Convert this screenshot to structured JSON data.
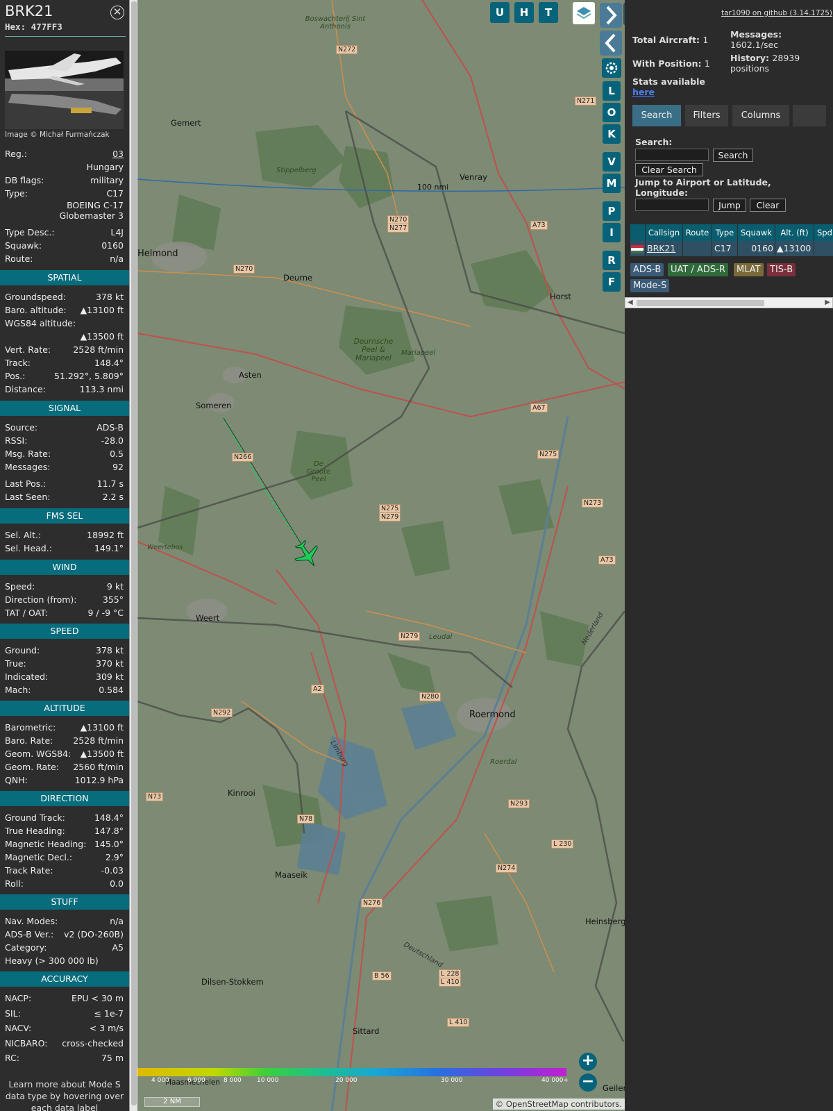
{
  "aircraft": {
    "callsign": "BRK21",
    "hex_label": "Hex:",
    "hex": "477FF3",
    "photo_credit": "Image © Michał Furmańczak",
    "reg_label": "Reg.:",
    "reg": "03",
    "country": "Hungary",
    "dbflags_label": "DB flags:",
    "dbflags": "military",
    "type_label": "Type:",
    "type": "C17",
    "type_name_1": "BOEING C-17",
    "type_name_2": "Globemaster 3",
    "typedesc_label": "Type Desc.:",
    "typedesc": "L4J",
    "squawk_label": "Squawk:",
    "squawk": "0160",
    "route_label": "Route:",
    "route": "n/a"
  },
  "sections": {
    "spatial": "SPATIAL",
    "signal": "SIGNAL",
    "fmssel": "FMS SEL",
    "wind": "WIND",
    "speed": "SPEED",
    "altitude": "ALTITUDE",
    "direction": "DIRECTION",
    "stuff": "STUFF",
    "accuracy": "ACCURACY"
  },
  "spatial": [
    {
      "k": "Groundspeed:",
      "v": "378 kt"
    },
    {
      "k": "Baro. altitude:",
      "v": "▲13100 ft"
    },
    {
      "k": "WGS84 altitude:",
      "v": ""
    },
    {
      "k": "",
      "v": "▲13500 ft"
    },
    {
      "k": "Vert. Rate:",
      "v": "2528 ft/min"
    },
    {
      "k": "Track:",
      "v": "148.4°"
    },
    {
      "k": "Pos.:",
      "v": "51.292°, 5.809°"
    },
    {
      "k": "Distance:",
      "v": "113.3 nmi"
    }
  ],
  "signal": [
    {
      "k": "Source:",
      "v": "ADS-B"
    },
    {
      "k": "RSSI:",
      "v": "-28.0"
    },
    {
      "k": "Msg. Rate:",
      "v": "0.5"
    },
    {
      "k": "Messages:",
      "v": "92"
    },
    {
      "k": "Last Pos.:",
      "v": "11.7 s"
    },
    {
      "k": "Last Seen:",
      "v": "2.2 s"
    }
  ],
  "fmssel": [
    {
      "k": "Sel. Alt.:",
      "v": "18992 ft"
    },
    {
      "k": "Sel. Head.:",
      "v": "149.1°"
    }
  ],
  "wind": [
    {
      "k": "Speed:",
      "v": "9 kt"
    },
    {
      "k": "Direction (from):",
      "v": "355°"
    },
    {
      "k": "TAT / OAT:",
      "v": "9 / -9 °C"
    }
  ],
  "speed": [
    {
      "k": "Ground:",
      "v": "378 kt"
    },
    {
      "k": "True:",
      "v": "370 kt"
    },
    {
      "k": "Indicated:",
      "v": "309 kt"
    },
    {
      "k": "Mach:",
      "v": "0.584"
    }
  ],
  "altitude": [
    {
      "k": "Barometric:",
      "v": "▲13100 ft"
    },
    {
      "k": "Baro. Rate:",
      "v": "2528 ft/min"
    },
    {
      "k": "Geom. WGS84:",
      "v": "▲13500 ft"
    },
    {
      "k": "Geom. Rate:",
      "v": "2560 ft/min"
    },
    {
      "k": "QNH:",
      "v": "1012.9 hPa"
    }
  ],
  "direction": [
    {
      "k": "Ground Track:",
      "v": "148.4°"
    },
    {
      "k": "True Heading:",
      "v": "147.8°"
    },
    {
      "k": "Magnetic Heading:",
      "v": "145.0°"
    },
    {
      "k": "Magnetic Decl.:",
      "v": "2.9°"
    },
    {
      "k": "Track Rate:",
      "v": "-0.03"
    },
    {
      "k": "Roll:",
      "v": "0.0"
    }
  ],
  "stuff": [
    {
      "k": "Nav. Modes:",
      "v": "n/a"
    },
    {
      "k": "ADS-B Ver.:",
      "v": "v2 (DO-260B)"
    },
    {
      "k": "Category:",
      "v": "A5"
    },
    {
      "k": "Heavy (> 300 000 lb)",
      "v": ""
    }
  ],
  "accuracy": [
    {
      "k": "NACP:",
      "v": "EPU < 30 m"
    },
    {
      "k": "SIL:",
      "v": "≤ 1e-7"
    },
    {
      "k": "NACV:",
      "v": "< 3 m/s"
    },
    {
      "k": "NICBARO:",
      "v": "cross-checked"
    },
    {
      "k": "RC:",
      "v": "75 m"
    }
  ],
  "footer_note_1": "Learn more about Mode S",
  "footer_note_2": "data type by hovering over",
  "footer_note_3": "each data label",
  "map": {
    "top_buttons": [
      "U",
      "H",
      "T"
    ],
    "side_buttons": [
      "L",
      "O",
      "K",
      "V",
      "M",
      "P",
      "I",
      "R",
      "F"
    ],
    "range_ring_label": "100 nmi",
    "scale_label": "2 NM",
    "attribution": "© OpenStreetMap contributors.",
    "alt_legend": [
      "4 000",
      "6 000",
      "8 000",
      "10 000",
      "20 000",
      "30 000",
      "40 000+"
    ],
    "zoom_in": "+",
    "zoom_out": "−",
    "places": [
      "Boswachterij Sint Anthonis",
      "Gemert",
      "Stippelberg",
      "Venray",
      "Helmond",
      "Deurne",
      "Horst",
      "Deurnsche Peel & Mariapeel",
      "Mariapeel",
      "Asten",
      "Someren",
      "De Groote Peel",
      "Weertebos",
      "Weert",
      "Roermond",
      "Leudal",
      "Kinrooi",
      "Maaseik",
      "Heinsberg",
      "Dilsen-Stokkem",
      "Sittard",
      "Maasmechelen",
      "Geilen",
      "Roerdal",
      "Nederland",
      "Deutschland",
      "Limburg"
    ],
    "roads": [
      "N272",
      "N271",
      "N270",
      "N277",
      "N270",
      "A73",
      "N266",
      "N275",
      "N279",
      "N275",
      "N273",
      "A67",
      "A73",
      "N279",
      "N280",
      "A2",
      "N292",
      "N73",
      "N78",
      "N293",
      "L 230",
      "N274",
      "N276",
      "B 56",
      "L 228",
      "L 410",
      "L 410"
    ]
  },
  "right": {
    "github_link": "tar1090 on github (3.14.1725)",
    "total_aircraft_label": "Total Aircraft:",
    "total_aircraft": "1",
    "with_position_label": "With Position:",
    "with_position": "1",
    "messages_label": "Messages:",
    "messages": "1602.1/sec",
    "history_label": "History:",
    "history": "28939 positions",
    "stats_label": "Stats available",
    "stats_link": "here",
    "tabs": [
      "Search",
      "Filters",
      "Columns"
    ],
    "search_label": "Search:",
    "search_button": "Search",
    "clear_search_button": "Clear Search",
    "jump_label": "Jump to Airport or Latitude, Longitude:",
    "jump_button": "Jump",
    "clear_button": "Clear",
    "table_headers": [
      "Callsign",
      "Route",
      "Type",
      "Squawk",
      "Alt. (ft)",
      "Spd"
    ],
    "table_row": {
      "callsign": "BRK21",
      "route": "",
      "type": "C17",
      "squawk": "0160",
      "alt": "▲13100"
    },
    "badges": [
      "ADS-B",
      "UAT / ADS-R",
      "MLAT",
      "TIS-B",
      "Mode-S"
    ]
  },
  "colors": {
    "accent": "#076c7c",
    "aircraft": "#1fcc5a",
    "map_base": "#7d8a74"
  }
}
